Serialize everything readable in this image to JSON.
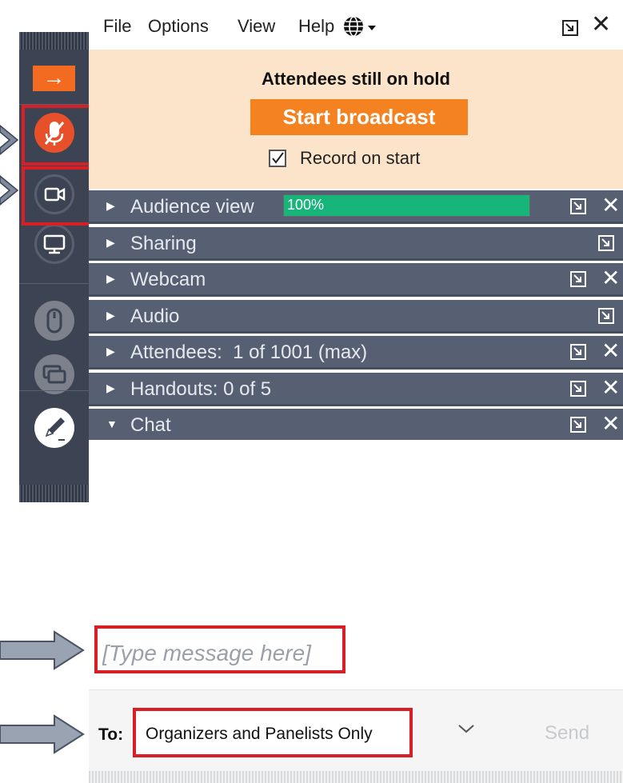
{
  "menu": {
    "file": "File",
    "options": "Options",
    "view": "View",
    "help": "Help",
    "globe_icon": "globe-icon",
    "restore_icon": "popout-icon",
    "close_icon": "close-icon",
    "close_glyph": "✕"
  },
  "hold_banner": {
    "title": "Attendees still on hold",
    "start_button": "Start broadcast",
    "record_checkbox_label": "Record on start",
    "record_checked": true,
    "background_color": "#fbe4ca",
    "button_color": "#f58220"
  },
  "panels": [
    {
      "label": "Audience view",
      "popout": true,
      "close": true,
      "progress_label": "100%",
      "progress_fraction": 1.0
    },
    {
      "label": "Sharing",
      "popout": true,
      "close": false
    },
    {
      "label": "Webcam",
      "popout": true,
      "close": true
    },
    {
      "label": "Audio",
      "popout": true,
      "close": false
    },
    {
      "label": "Attendees:  1 of 1001 (max)",
      "popout": true,
      "close": true
    },
    {
      "label": "Handouts: 0 of 5",
      "popout": true,
      "close": true
    },
    {
      "label": "Chat",
      "popout": true,
      "close": true,
      "expanded": true
    }
  ],
  "chat": {
    "message_placeholder": "[Type message here]",
    "to_label": "To:",
    "recipient_selected": "Organizers and Panelists Only",
    "send_label": "Send"
  },
  "control_strip": {
    "items": [
      "arrow-right-icon",
      "microphone-icon",
      "webcam-icon",
      "screen-share-icon",
      "mouse-icon",
      "chat-monitor-icon",
      "pen-icon"
    ],
    "accent_color": "#e8502a"
  },
  "colors": {
    "highlight_box": "#d81f26",
    "panel_bar": "#566072",
    "progress_fill": "#17b57a"
  }
}
